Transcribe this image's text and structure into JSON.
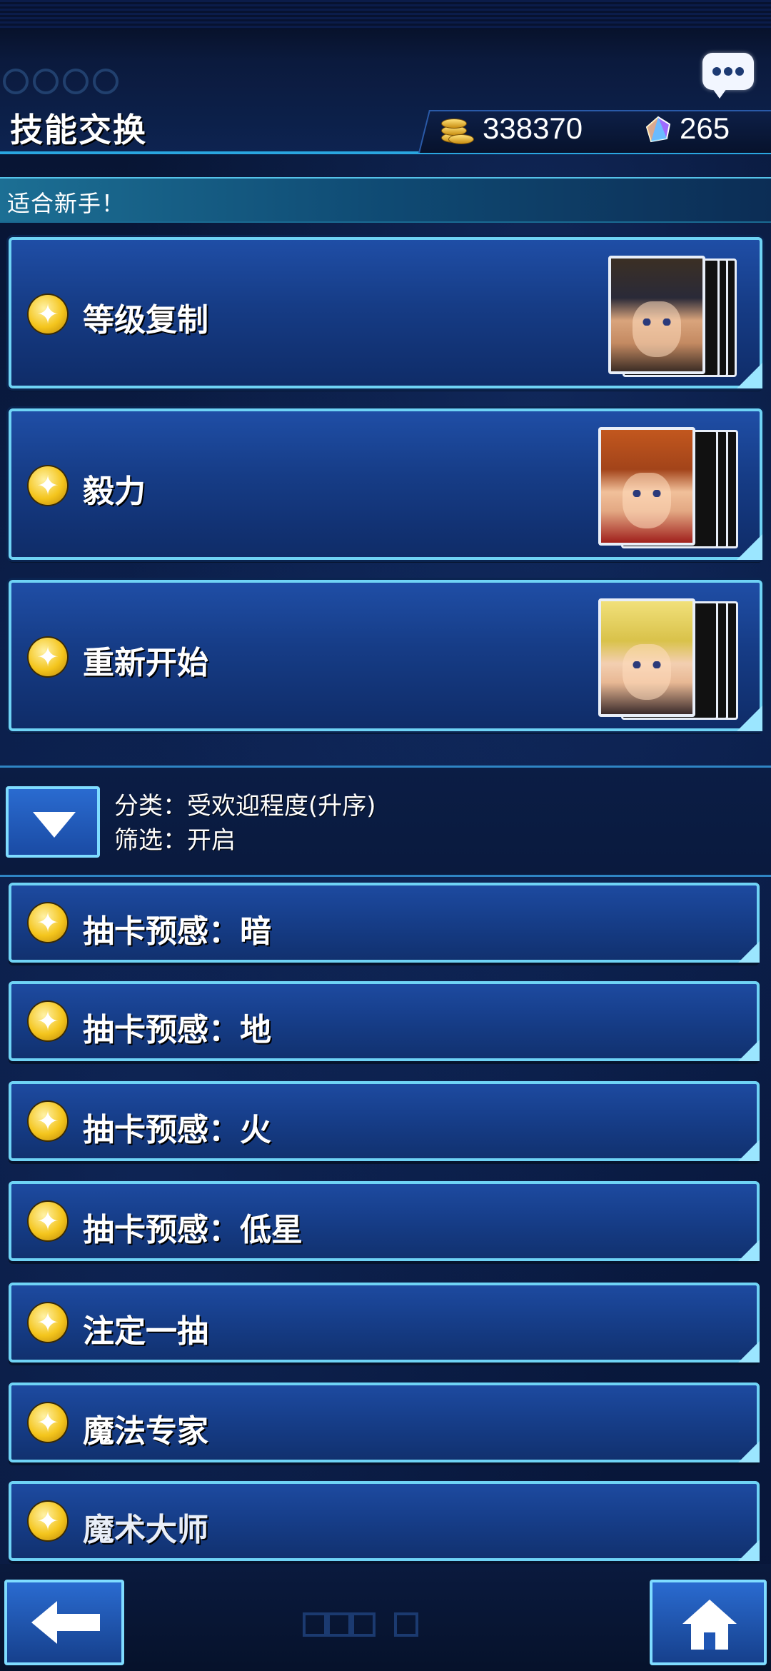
{
  "header": {
    "title": "技能交换",
    "gold": "338370",
    "gems": "265",
    "icons": {
      "chat": "chat-bubble-icon",
      "gold": "gold-coins-icon",
      "gem": "gem-icon"
    }
  },
  "featured_section": {
    "label": "适合新手！",
    "items": [
      {
        "label": "等级复制",
        "character": "character-portrait-yusei"
      },
      {
        "label": "毅力",
        "character": "character-portrait-jaden"
      },
      {
        "label": "重新开始",
        "character": "character-portrait-yami-marik"
      }
    ]
  },
  "sort_bar": {
    "sort_line": "分类：受欢迎程度(升序)",
    "filter_line": "筛选：开启"
  },
  "skill_list": [
    {
      "label": "抽卡预感：暗"
    },
    {
      "label": "抽卡预感：地"
    },
    {
      "label": "抽卡预感：火"
    },
    {
      "label": "抽卡预感：低星"
    },
    {
      "label": "注定一抽"
    },
    {
      "label": "魔法专家"
    },
    {
      "label": "魔术大师"
    }
  ],
  "colors": {
    "accent_border": "#6fd3f5",
    "card_fill": "#163c86",
    "star": "#f4c51d",
    "section_header": "#1c6f94"
  }
}
